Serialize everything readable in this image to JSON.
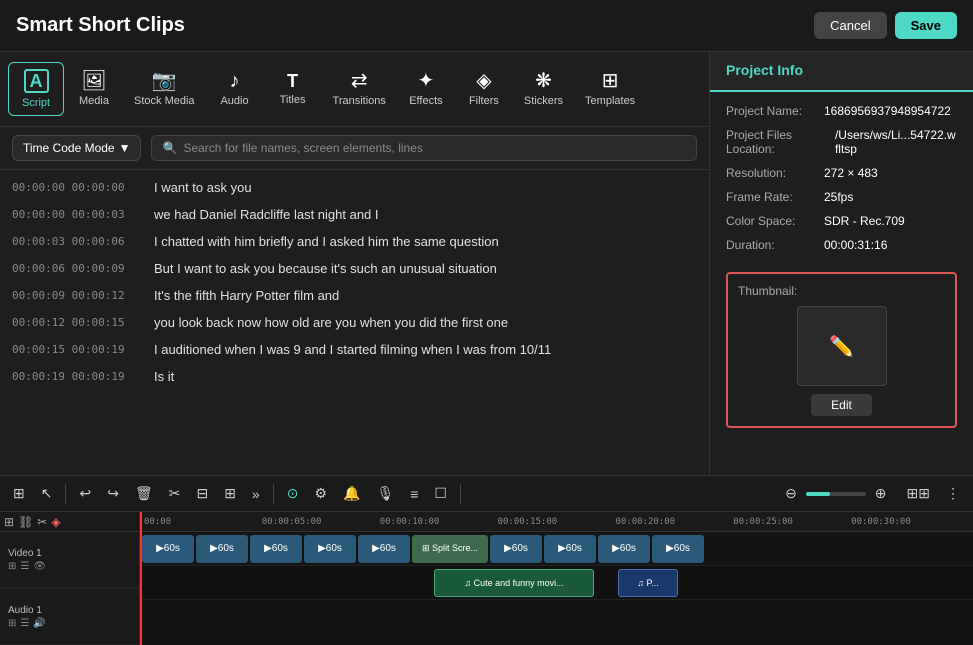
{
  "app": {
    "title": "Smart Short Clips"
  },
  "header": {
    "cancel_label": "Cancel",
    "save_label": "Save"
  },
  "toolbar": {
    "items": [
      {
        "id": "script",
        "icon": "A",
        "label": "Script",
        "active": true
      },
      {
        "id": "media",
        "icon": "🖼",
        "label": "Media",
        "active": false
      },
      {
        "id": "stock-media",
        "icon": "📷",
        "label": "Stock Media",
        "active": false
      },
      {
        "id": "audio",
        "icon": "♪",
        "label": "Audio",
        "active": false
      },
      {
        "id": "titles",
        "icon": "T",
        "label": "Titles",
        "active": false
      },
      {
        "id": "transitions",
        "icon": "↔",
        "label": "Transitions",
        "active": false
      },
      {
        "id": "effects",
        "icon": "★",
        "label": "Effects",
        "active": false
      },
      {
        "id": "filters",
        "icon": "⊕",
        "label": "Filters",
        "active": false
      },
      {
        "id": "stickers",
        "icon": "✦",
        "label": "Stickers",
        "active": false
      },
      {
        "id": "templates",
        "icon": "⊞",
        "label": "Templates",
        "active": false
      }
    ]
  },
  "script_controls": {
    "mode_label": "Time Code Mode",
    "search_placeholder": "Search for file names, screen elements, lines"
  },
  "script_lines": [
    {
      "start": "00:00:00",
      "end": "00:00:00",
      "text": "I want to ask you"
    },
    {
      "start": "00:00:00",
      "end": "00:00:03",
      "text": "we had Daniel Radcliffe last night and I"
    },
    {
      "start": "00:00:03",
      "end": "00:00:06",
      "text": "I chatted with him briefly and I asked him the same question"
    },
    {
      "start": "00:00:06",
      "end": "00:00:09",
      "text": "But I want to ask you because it's such an unusual situation"
    },
    {
      "start": "00:00:09",
      "end": "00:00:12",
      "text": "It's the fifth Harry Potter film and"
    },
    {
      "start": "00:00:12",
      "end": "00:00:15",
      "text": "you look back now how old are you when you did the first one"
    },
    {
      "start": "00:00:15",
      "end": "00:00:19",
      "text": "I auditioned when I was 9 and I started filming when I was from 10/11"
    },
    {
      "start": "00:00:19",
      "end": "00:00:19",
      "text": "Is it"
    }
  ],
  "right_panel": {
    "title": "Project Info",
    "fields": [
      {
        "label": "Project Name:",
        "value": "1686956937948954722"
      },
      {
        "label": "Project Files Location:",
        "value": "/Users/ws/Li...54722.wfltsp"
      },
      {
        "label": "Resolution:",
        "value": "272 × 483"
      },
      {
        "label": "Frame Rate:",
        "value": "25fps"
      },
      {
        "label": "Color Space:",
        "value": "SDR - Rec.709"
      },
      {
        "label": "Duration:",
        "value": "00:00:31:16"
      }
    ],
    "thumbnail_label": "Thumbnail:",
    "edit_label": "Edit"
  },
  "timeline": {
    "toolbar_buttons": [
      "⊞",
      "↖",
      "|",
      "↩",
      "↪",
      "🗑",
      "✂",
      "⊟",
      "⊞",
      "»",
      "⊙",
      "⚙",
      "🔔",
      "🎙",
      "≡",
      "⊞",
      "☐",
      "⊕",
      "⊖"
    ],
    "ruler_marks": [
      "00:00",
      "00:00:05:00",
      "00:00:10:00",
      "00:00:15:00",
      "00:00:20:00",
      "00:00:25:00",
      "00:00:30:00"
    ],
    "tracks": [
      {
        "name": "Video 1",
        "type": "video"
      },
      {
        "name": "Audio 1",
        "type": "audio"
      }
    ]
  }
}
